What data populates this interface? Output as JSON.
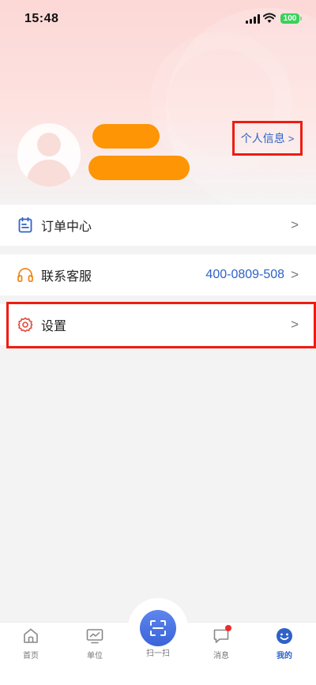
{
  "status_bar": {
    "time": "15:48",
    "battery": "100"
  },
  "profile": {
    "info_link_label": "个人信息",
    "info_link_chevron": ">"
  },
  "menu": {
    "orders_label": "订单中心",
    "service_label": "联系客服",
    "service_phone": "400-0809-508",
    "settings_label": "设置",
    "chevron": ">"
  },
  "tabbar": {
    "home": "首页",
    "unit": "单位",
    "scan": "扫一扫",
    "messages": "消息",
    "mine": "我的",
    "active": "mine"
  },
  "colors": {
    "accent_blue": "#2f62c8",
    "redacted": "#fd9505",
    "highlight_box": "#ee1c12",
    "orders_icon": "#2f62c8",
    "service_icon": "#f08a1c",
    "settings_icon": "#e34a3c"
  }
}
